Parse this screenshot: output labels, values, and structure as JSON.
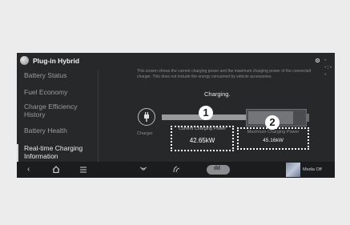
{
  "header": {
    "title": "Plug-in Hybrid",
    "status_text": "--:--"
  },
  "sidebar": {
    "items": [
      {
        "label": "Battery Status"
      },
      {
        "label": "Fuel Economy"
      },
      {
        "label": "Charge Efficiency History"
      },
      {
        "label": "Battery Health"
      },
      {
        "label": "Real-time Charging Information",
        "active": true
      }
    ]
  },
  "main": {
    "description": "This screen shows the current charging power and the maximum charging power of the connected charger. This does not include the energy consumed by vehicle accessories.",
    "status": "Charging.",
    "charger_label": "Charger",
    "current_power_label": "Current Charging Power",
    "current_power_value": "42.65kW",
    "max_power_label": "Maximum Charging Power",
    "max_power_value": "45.16kW",
    "battery_level": 0.8,
    "markers": [
      "1",
      "2"
    ]
  },
  "bottom_bar": {
    "media_label": "Media Off",
    "icons": [
      "back-icon",
      "home-icon",
      "menu-icon",
      "fan-icon",
      "drive-mode-icon",
      "energy-chart-icon"
    ]
  },
  "colors": {
    "screen_bg": "#26282a",
    "active_text": "#ebebeb",
    "inactive_text": "#9c9c9c"
  }
}
